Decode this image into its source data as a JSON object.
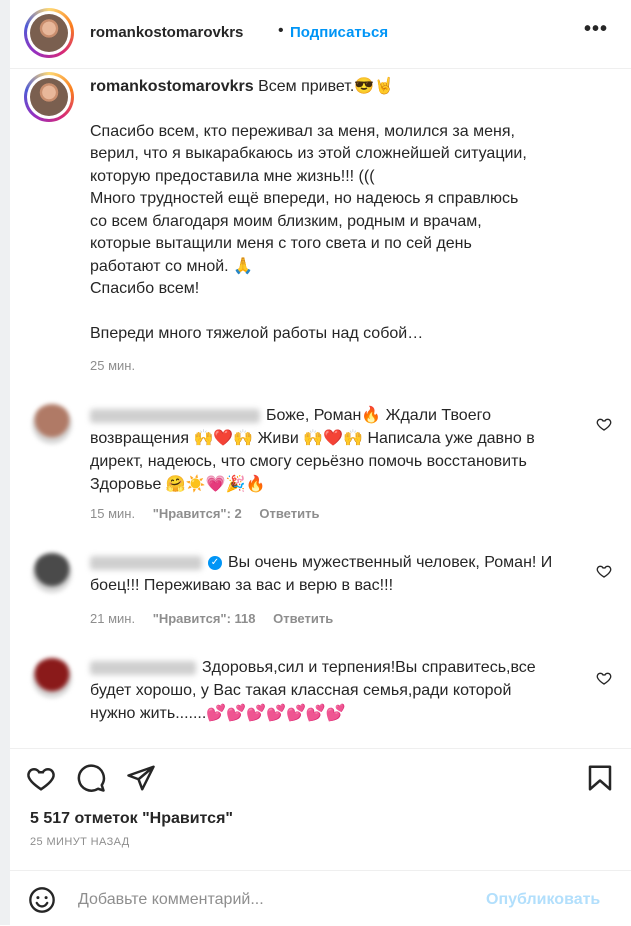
{
  "header": {
    "username": "romankostomarovkrs",
    "dot": "•",
    "follow_label": "Подписаться",
    "more_label": "•••"
  },
  "caption": {
    "username": "romankostomarovkrs",
    "greeting": "Всем привет.😎🤘",
    "paragraph1": "Спасибо всем, кто переживал за меня, молился за меня,\nверил, что я выкарабкаюсь из этой сложнейшей ситуации,\nкоторую предоставила мне жизнь!!! (((\nМного трудностей ещё впереди, но надеюсь я справлюсь\nсо всем благодаря моим близким, родным и врачам,\nкоторые вытащили меня с того света и по сей день\nработают со мной. 🙏\nСпасибо всем!",
    "paragraph2": "Впереди много тяжелой работы над собой…",
    "time": "25 мин."
  },
  "comments": [
    {
      "text": "Боже, Роман🔥 Ждали Твоего возвращения 🙌❤️🙌 Живи 🙌❤️🙌 Написала уже давно в директ, надеюсь, что смогу серьёзно помочь восстановить Здоровье 🤗☀️💗🎉🔥",
      "time": "15 мин.",
      "likes": "\"Нравится\": 2",
      "reply": "Ответить",
      "avatar_color": "#b07a66"
    },
    {
      "text": "Вы очень мужественный человек, Роман! И боец!!! Переживаю за вас и верю в вас!!!",
      "time": "21 мин.",
      "likes": "\"Нравится\": 118",
      "reply": "Ответить",
      "avatar_color": "#4a4a4a"
    },
    {
      "text": "Здоровья,сил и терпения!Вы справитесь,все будет хорошо, у Вас такая классная семья,ради которой нужно жить.......💕💕💕💕💕💕💕",
      "time": "",
      "likes": "",
      "reply": "",
      "avatar_color": "#8a1a1a"
    }
  ],
  "icons": {
    "like": "heart-icon",
    "comment": "comment-bubble-icon",
    "share": "paper-plane-icon",
    "save": "bookmark-icon",
    "emoji": "smiley-icon"
  },
  "likes_text": "5 517 отметок \"Нравится\"",
  "posted_ago": "25 МИНУТ НАЗАД",
  "add_comment": {
    "placeholder": "Добавьте комментарий...",
    "publish_label": "Опубликовать"
  },
  "colors": {
    "accent": "#0095f6",
    "publish_disabled": "#b2dffc",
    "secondary_text": "#8e8e8e"
  }
}
